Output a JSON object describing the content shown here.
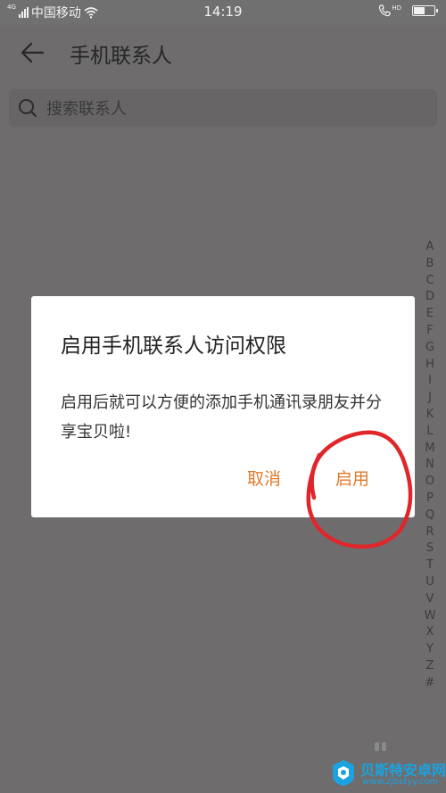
{
  "status_bar": {
    "network_type": "4G",
    "carrier": "中国移动",
    "time": "14:19",
    "call_badge": "HD",
    "battery_level": 0.55
  },
  "header": {
    "back_icon": "arrow-left-icon",
    "title": "手机联系人"
  },
  "search": {
    "icon": "search-icon",
    "placeholder": "搜索联系人",
    "value": ""
  },
  "alphabet_index": [
    "A",
    "B",
    "C",
    "D",
    "E",
    "F",
    "G",
    "H",
    "I",
    "J",
    "K",
    "L",
    "M",
    "N",
    "O",
    "P",
    "Q",
    "R",
    "S",
    "T",
    "U",
    "V",
    "W",
    "X",
    "Y",
    "Z",
    "#"
  ],
  "dialog": {
    "title": "启用手机联系人访问权限",
    "message": "启用后就可以方便的添加手机通讯录朋友并分享宝贝啦!",
    "cancel_label": "取消",
    "enable_label": "启用"
  },
  "colors": {
    "overlay_bg": "#6e6c6d",
    "dialog_bg": "#ffffff",
    "accent": "#e07a2a",
    "annotation": "#e0262a",
    "watermark": "#1aa3e0"
  },
  "watermark": {
    "title": "贝斯特安卓网",
    "url": "www.zjbstyy.com"
  }
}
